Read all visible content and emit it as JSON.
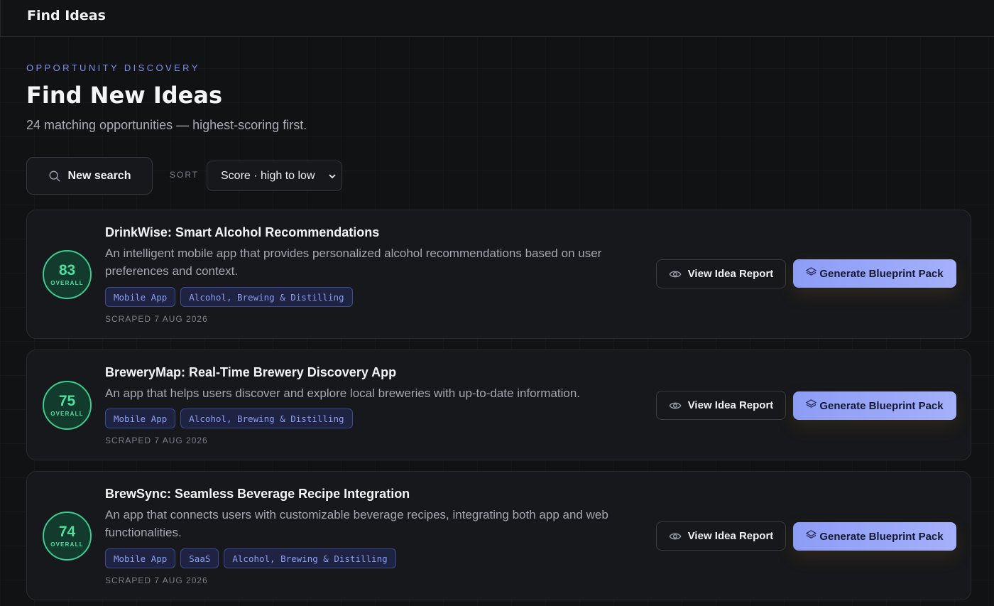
{
  "topbar": {
    "title": "Find Ideas"
  },
  "header": {
    "eyebrow": "OPPORTUNITY DISCOVERY",
    "title": "Find New Ideas",
    "subtitle": "24 matching opportunities — highest-scoring first."
  },
  "controls": {
    "new_search_label": "New search",
    "sort_label": "SORT",
    "sort_selected": "Score · high to low"
  },
  "cards": [
    {
      "score": "83",
      "score_label": "OVERALL",
      "title": "DrinkWise: Smart Alcohol Recommendations",
      "description": "An intelligent mobile app that provides personalized alcohol recommendations based on user preferences and context.",
      "tags": [
        "Mobile App",
        "Alcohol, Brewing & Distilling"
      ],
      "scraped": "SCRAPED 7 AUG 2026",
      "view_label": "View Idea Report",
      "generate_label": "Generate Blueprint Pack"
    },
    {
      "score": "75",
      "score_label": "OVERALL",
      "title": "BreweryMap: Real-Time Brewery Discovery App",
      "description": "An app that helps users discover and explore local breweries with up-to-date information.",
      "tags": [
        "Mobile App",
        "Alcohol, Brewing & Distilling"
      ],
      "scraped": "SCRAPED 7 AUG 2026",
      "view_label": "View Idea Report",
      "generate_label": "Generate Blueprint Pack"
    },
    {
      "score": "74",
      "score_label": "OVERALL",
      "title": "BrewSync: Seamless Beverage Recipe Integration",
      "description": "An app that connects users with customizable beverage recipes, integrating both app and web functionalities.",
      "tags": [
        "Mobile App",
        "SaaS",
        "Alcohol, Brewing & Distilling"
      ],
      "scraped": "SCRAPED 7 AUG 2026",
      "view_label": "View Idea Report",
      "generate_label": "Generate Blueprint Pack"
    }
  ],
  "colors": {
    "accent": "#8d9cf6",
    "score_green": "#4fe0a0",
    "background": "#111214"
  },
  "icons": {
    "search": "search-icon",
    "eye": "eye-icon",
    "layers": "layers-icon",
    "chevron": "chevron-down-icon"
  }
}
